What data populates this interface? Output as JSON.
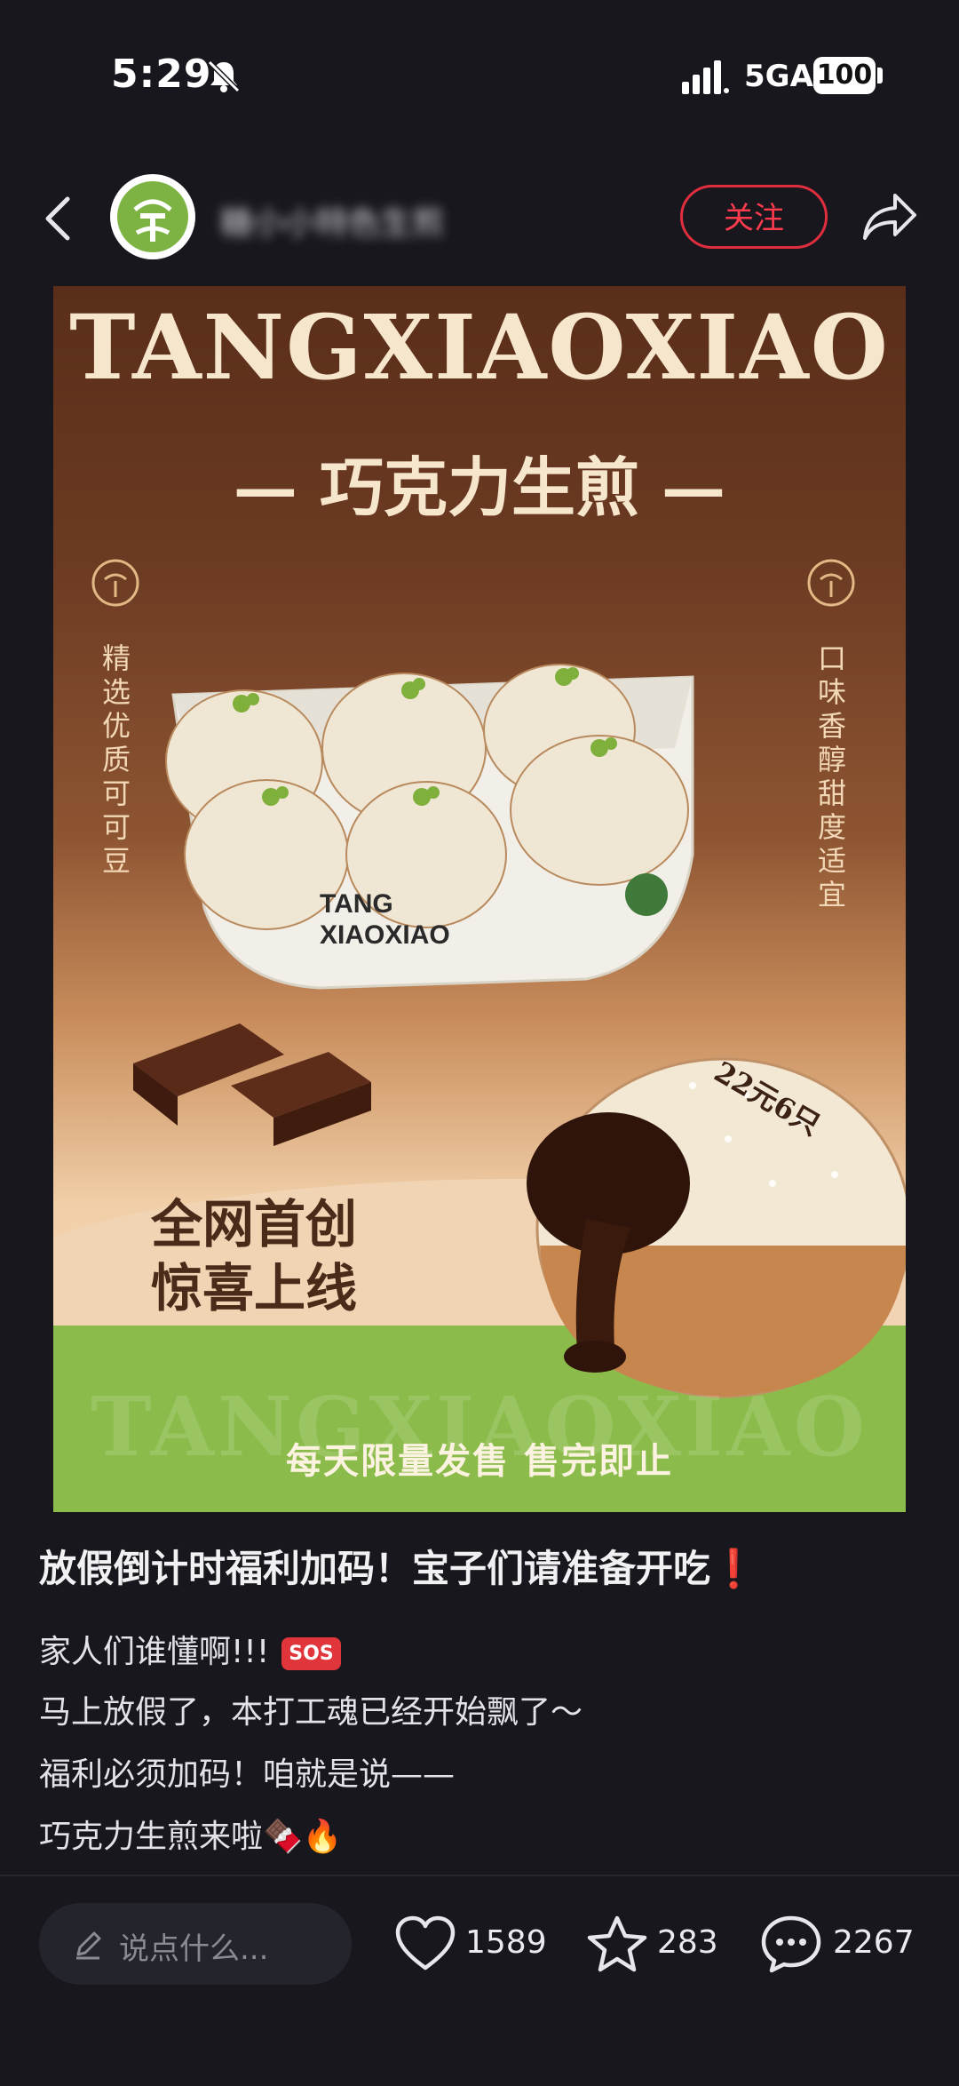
{
  "status_bar": {
    "time": "5:29",
    "network": "5GA",
    "battery": "100"
  },
  "header": {
    "author_name": "糖小小特色生煎",
    "follow_label": "关注"
  },
  "poster": {
    "brand": "TANGXIAOXIAO",
    "subtitle": "— 巧克力生煎 —",
    "left_vertical": "精选优质可可豆",
    "right_vertical": "口味香醇甜度适宜",
    "box_text_line1": "TANG",
    "box_text_line2": "XIAOXIAO",
    "price": "22元6只",
    "tagline_line1": "全网首创",
    "tagline_line2": "惊喜上线",
    "watermark": "TANGXIAOXIAO",
    "bottom_text": "每天限量发售  售完即止"
  },
  "post": {
    "title": "放假倒计时福利加码！宝子们请准备开吃❗",
    "lines": [
      "家人们谁懂啊!!!",
      "马上放假了，本打工魂已经开始飘了～",
      "福利必须加码！咱就是说——",
      "巧克力生煎来啦🍫🔥"
    ],
    "sos_badge": "SOS"
  },
  "bottom_bar": {
    "comment_placeholder": "说点什么...",
    "likes": "1589",
    "favorites": "283",
    "comments": "2267"
  }
}
